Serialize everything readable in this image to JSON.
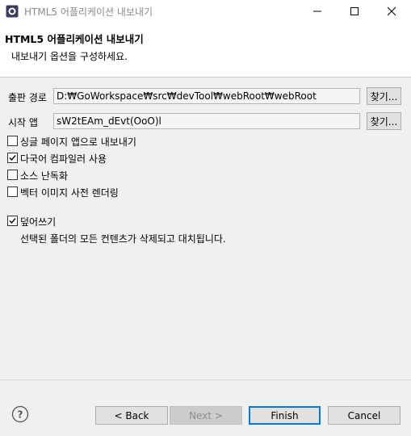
{
  "window": {
    "title": "HTML5 어플리케이션 내보내기"
  },
  "header": {
    "title": "HTML5 어플리케이션 내보내기",
    "subtitle": "내보내기 옵션을 구성하세요."
  },
  "form": {
    "output_path": {
      "label": "출판 경로",
      "value": "D:₩GoWorkspace₩src₩devTool₩webRoot₩webRoot",
      "browse_label": "찾기..."
    },
    "start_app": {
      "label": "시작 앱",
      "value": "sW2tEAm_dEvt(OoO)l",
      "browse_label": "찾기..."
    }
  },
  "options": [
    {
      "label": "싱글 페이지 앱으로 내보내기",
      "checked": false
    },
    {
      "label": "다국어 컴파일러 사용",
      "checked": true
    },
    {
      "label": "소스 난독화",
      "checked": false
    },
    {
      "label": "벡터 이미지 사전 렌더링",
      "checked": false
    }
  ],
  "overwrite": {
    "label": "덮어쓰기",
    "checked": true,
    "description": "선택된 폴더의 모든 컨텐츠가 삭제되고 대치됩니다."
  },
  "buttons": {
    "back": "< Back",
    "next": "Next >",
    "finish": "Finish",
    "cancel": "Cancel"
  },
  "icons": {
    "app": "eclipse-app-icon",
    "help": "help-icon",
    "minimize": "minimize-icon",
    "maximize": "maximize-icon",
    "close": "close-icon"
  },
  "colors": {
    "accent": "#0078d7",
    "header_bg": "#ffffff",
    "dialog_bg": "#f0f0f0"
  }
}
